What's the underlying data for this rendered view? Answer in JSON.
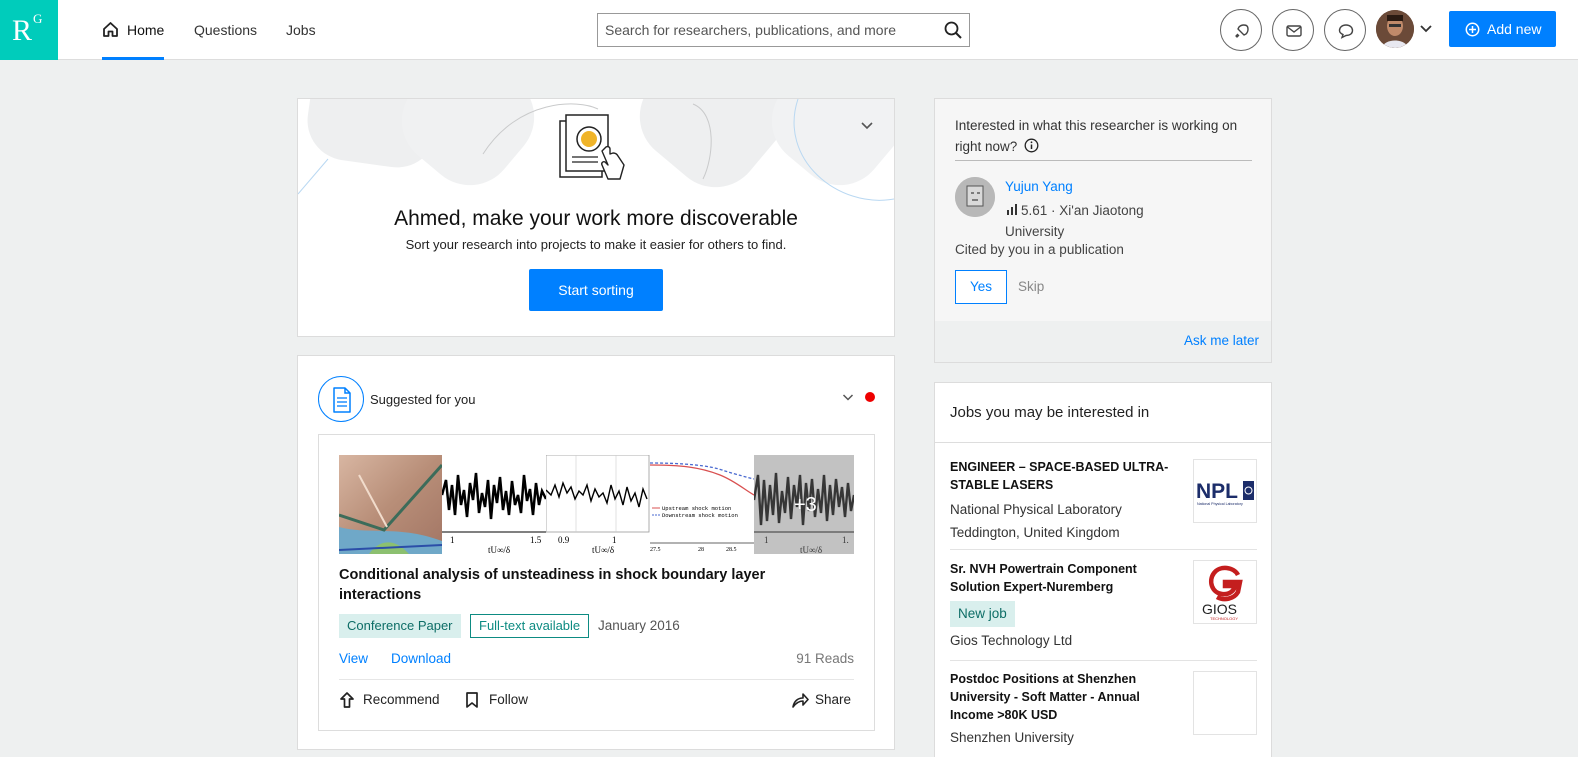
{
  "header": {
    "logo_r": "R",
    "logo_g": "G",
    "nav": [
      {
        "label": "Home",
        "active": true
      },
      {
        "label": "Questions",
        "active": false
      },
      {
        "label": "Jobs",
        "active": false
      }
    ],
    "search_placeholder": "Search for researchers, publications, and more",
    "add_new_label": "Add new",
    "accent_color": "#0080ff",
    "brand_color": "#00ccbb"
  },
  "hero": {
    "title": "Ahmed, make your work more discoverable",
    "subtitle": "Sort your research into projects to make it easier for others to find.",
    "button_label": "Start sorting"
  },
  "feed": {
    "section_label": "Suggested for you",
    "publication": {
      "title": "Conditional analysis of unsteadiness in shock boundary layer interactions",
      "type": "Conference Paper",
      "fulltext_badge": "Full-text available",
      "date": "January 2016",
      "view_label": "View",
      "download_label": "Download",
      "reads": "91 Reads",
      "extra_figures": "+3",
      "figure_tick_labels": [
        [
          "1",
          "1.5",
          "tU∞/δ"
        ],
        [
          "0.9",
          "1",
          "tU∞/δ"
        ],
        [
          "27.5",
          "28",
          "28.5"
        ],
        [
          "1",
          "1.",
          "tU∞/δ"
        ]
      ],
      "figure_legend": [
        "Upstream shock motion",
        "Downstream shock motion"
      ],
      "recommend_label": "Recommend",
      "follow_label": "Follow",
      "share_label": "Share"
    }
  },
  "researcher_card": {
    "question": "Interested in what this researcher is working on right now?",
    "name": "Yujun Yang",
    "score": "5.61",
    "institution_line": "· Xi'an Jiaotong University",
    "cited_text": "Cited by you in a publication",
    "yes_label": "Yes",
    "skip_label": "Skip",
    "ask_later_label": "Ask me later"
  },
  "jobs": {
    "heading": "Jobs you may be interested in",
    "items": [
      {
        "title": "ENGINEER – SPACE-BASED ULTRA-STABLE LASERS",
        "org": "National Physical Laboratory",
        "location": "Teddington, United Kingdom",
        "logo_text": "NPL",
        "logo_sub": "National Physical Laboratory"
      },
      {
        "title": "Sr. NVH Powertrain Component Solution Expert-Nuremberg",
        "badge": "New job",
        "org": "Gios Technology Ltd",
        "logo_text": "GIOS",
        "logo_sub": "TECHNOLOGY"
      },
      {
        "title": "Postdoc Positions at Shenzhen University - Soft Matter - Annual Income >80K USD",
        "org": "Shenzhen University"
      }
    ]
  }
}
